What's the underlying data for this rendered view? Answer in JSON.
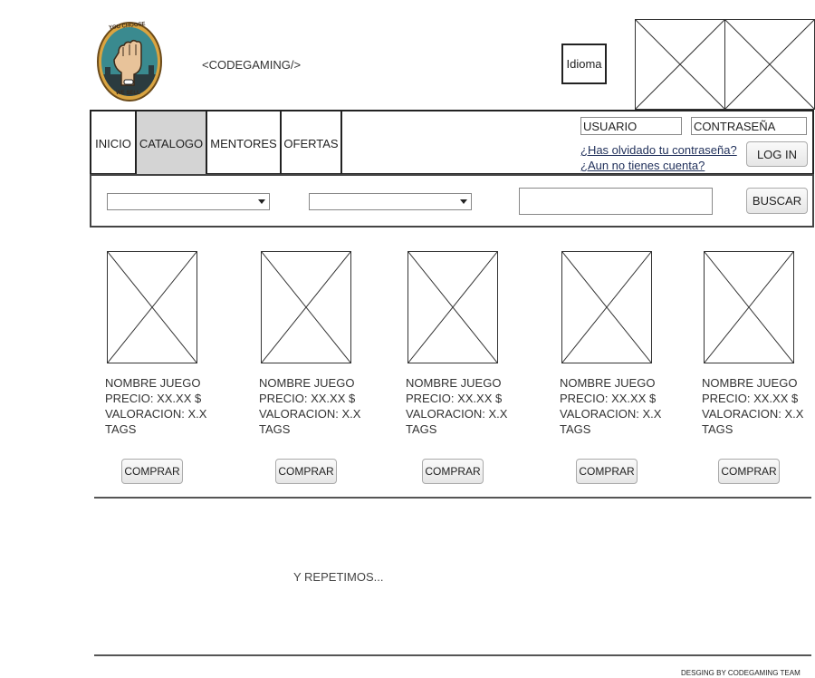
{
  "header": {
    "site_title": "<CODEGAMING/>",
    "logo_text_top": "YOU CHOOSE",
    "logo_text_bottom": "WE SELL",
    "language_button": "Idioma"
  },
  "nav": {
    "items": [
      {
        "label": "INICIO"
      },
      {
        "label": "CATALOGO"
      },
      {
        "label": "MENTORES"
      },
      {
        "label": "OFERTAS"
      }
    ],
    "active_index": 1,
    "active_color": "#d4d4d4"
  },
  "login": {
    "username_value": "USUARIO",
    "password_value": "CONTRASEÑA",
    "forgot_link": "¿Has olvidado tu contraseña?",
    "register_link": "¿Aun no tienes cuenta?",
    "login_button": "LOG IN"
  },
  "filters": {
    "search_value": "",
    "search_button": "BUSCAR"
  },
  "products": [
    {
      "name": "NOMBRE JUEGO",
      "price": "PRECIO: XX.XX $",
      "rating": "VALORACION: X.X",
      "tags": "TAGS",
      "buy": "COMPRAR"
    },
    {
      "name": "NOMBRE JUEGO",
      "price": "PRECIO: XX.XX $",
      "rating": "VALORACION: X.X",
      "tags": "TAGS",
      "buy": "COMPRAR"
    },
    {
      "name": "NOMBRE JUEGO",
      "price": "PRECIO: XX.XX $",
      "rating": "VALORACION: X.X",
      "tags": "TAGS",
      "buy": "COMPRAR"
    },
    {
      "name": "NOMBRE JUEGO",
      "price": "PRECIO: XX.XX $",
      "rating": "VALORACION: X.X",
      "tags": "TAGS",
      "buy": "COMPRAR"
    },
    {
      "name": "NOMBRE JUEGO",
      "price": "PRECIO: XX.XX $",
      "rating": "VALORACION: X.X",
      "tags": "TAGS",
      "buy": "COMPRAR"
    }
  ],
  "repeat_text": "Y REPETIMOS...",
  "footer": "DESGING BY CODEGAMING TEAM"
}
